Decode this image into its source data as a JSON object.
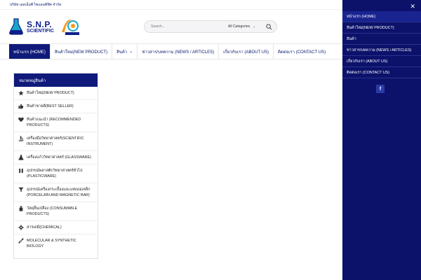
{
  "topbar": {
    "text": "บริษัท เอสเอ็นพี ไซแอนติฟิค จำกัด"
  },
  "logo": {
    "line1": "S.N.P.",
    "line2": "SCIENTIFIC"
  },
  "search": {
    "placeholder": "Search...",
    "category": "All Categories"
  },
  "nav": {
    "items": [
      {
        "label": "หน้าแรก (HOME)"
      },
      {
        "label": "สินค้าใหม่(NEW PRODUCT)"
      },
      {
        "label": "สินค้า"
      },
      {
        "label": "ข่าวสาร/บทความ (NEWS / ARTICLES)"
      },
      {
        "label": "เกี่ยวกับเรา (ABOUT US)"
      },
      {
        "label": "ติดต่อเรา (CONTACT US)"
      }
    ]
  },
  "categories": {
    "title": "หมวดหมู่สินค้า",
    "items": [
      {
        "label": "สินค้าใหม่(NEW PRODUCT)",
        "icon": "star-icon"
      },
      {
        "label": "สินค้าขายดี(BEST SELLER)",
        "icon": "thumbs-up-icon"
      },
      {
        "label": "สินค้าแนะนำ (RECOMMENDED PRODUCTS)",
        "icon": "heart-icon"
      },
      {
        "label": "เครื่องมือวิทยาศาสตร์(SCIENTIFIC INSTRUMENT)",
        "icon": "microscope-icon"
      },
      {
        "label": "เครื่องแก้ววิทยาศาสตร์ (GLASSWARE)",
        "icon": "flask-icon"
      },
      {
        "label": "อุปกรณ์พลาสติกวิทยาศาสตร์ทั่วไป (PLASTICWARE)",
        "icon": "test-tubes-icon"
      },
      {
        "label": "อุปกรณ์เครื่องกระเบื้องและแท่งแม่เหล็ก (PORCELAIN AND MAGNETIC BAR)",
        "icon": "funnel-icon"
      },
      {
        "label": "วัสดุสิ้นเปลือง (CONSUMABLE PRODUCTS)",
        "icon": "bottle-icon"
      },
      {
        "label": "สารเคมี(CHEMICAL)",
        "icon": "gear-icon"
      },
      {
        "label": "MOLECULAR & SYNTHETIC BIOLOGY",
        "icon": "dna-icon"
      }
    ]
  },
  "drawer": {
    "close": "✕",
    "items": [
      {
        "label": "หน้าแรก (HOME)"
      },
      {
        "label": "สินค้าใหม่(NEW PRODUCT)"
      },
      {
        "label": "สินค้า"
      },
      {
        "label": "ข่าวสาร/บทความ (NEWS / ARTICLES)"
      },
      {
        "label": "เกี่ยวกับเรา (ABOUT US)"
      },
      {
        "label": "ติดต่อเรา (CONTACT US)"
      }
    ],
    "social": "f"
  },
  "colors": {
    "navy": "#0f1a7a",
    "drawer": "#0c126a",
    "accent": "#2a3aa8"
  }
}
